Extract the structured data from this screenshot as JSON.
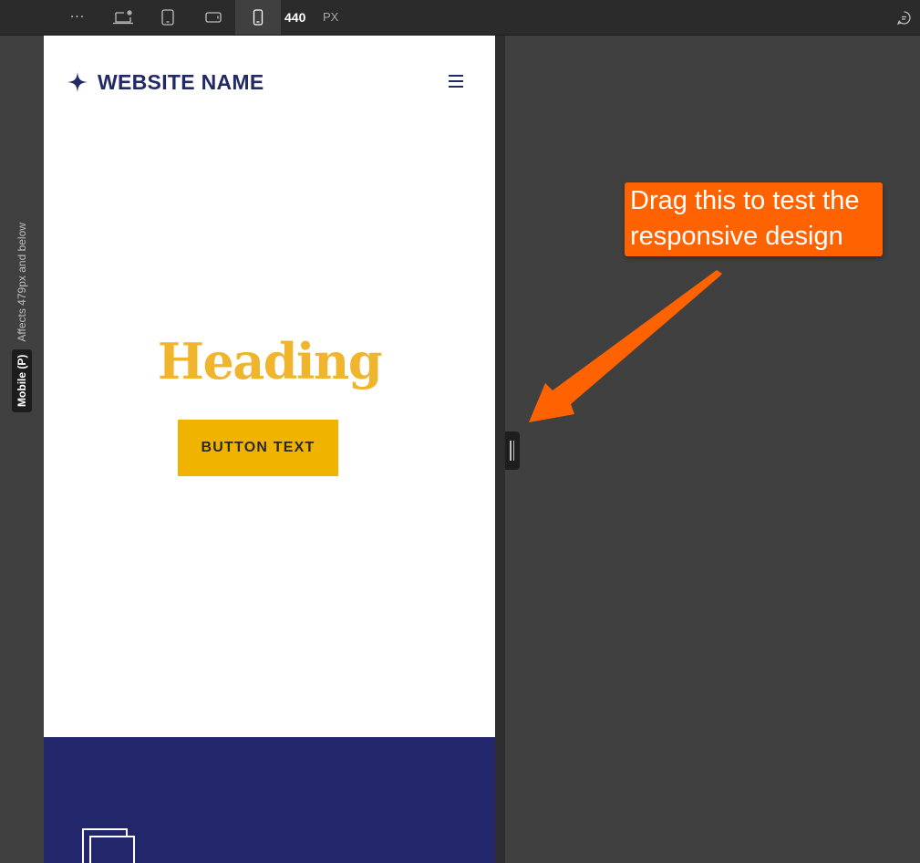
{
  "toolbar": {
    "more_label": "···",
    "breakpoints": [
      {
        "name": "Desktop (base breakpoint)",
        "icon": "desktop-star-icon"
      },
      {
        "name": "Tablet",
        "icon": "tablet-icon"
      },
      {
        "name": "Mobile landscape",
        "icon": "mobile-landscape-icon"
      },
      {
        "name": "Mobile portrait",
        "icon": "mobile-portrait-icon",
        "active": true
      }
    ],
    "width_value": "440",
    "width_unit": "PX",
    "comments_icon": "comment-icon"
  },
  "breakpoint_label": {
    "name": "Mobile (P)",
    "note": "Affects 479px and below"
  },
  "site": {
    "logo_icon": "sparkle-star-icon",
    "name": "WEBSITE NAME",
    "menu_icon": "hamburger-menu-icon",
    "heading": "Heading",
    "button_text": "BUTTON TEXT",
    "footer_icon": "stacked-squares-icon"
  },
  "colors": {
    "brand_navy": "#222a66",
    "heading_gold": "#f0b52d",
    "button_gold": "#f0b400",
    "footer_navy": "#22276b",
    "callout_orange": "#ff6200"
  },
  "annotation": {
    "line1": "Drag this to test the",
    "line2": "responsive design"
  }
}
